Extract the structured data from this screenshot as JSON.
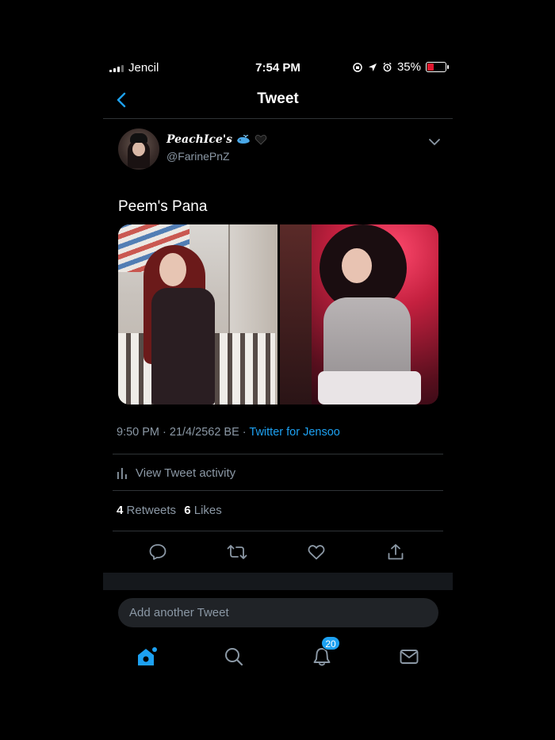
{
  "status_bar": {
    "carrier": "Jencil",
    "time": "7:54 PM",
    "battery": "35%",
    "battery_level": 0.35,
    "battery_color": "#e0152e"
  },
  "nav": {
    "title": "Tweet",
    "back_icon": "chevron-left-icon"
  },
  "tweet": {
    "display_name": "PeachIce's",
    "name_emojis": [
      "whale-icon",
      "black-heart-icon"
    ],
    "handle": "@FarinePnZ",
    "text": "Peem's Pana",
    "timestamp": "9:50 PM · 21/4/2562 BE · ",
    "source": "Twitter for Jensoo",
    "activity_label": "View Tweet activity",
    "retweets_count": "4",
    "retweets_label": "Retweets",
    "likes_count": "6",
    "likes_label": "Likes"
  },
  "actions": [
    "reply-icon",
    "retweet-icon",
    "like-icon",
    "share-icon"
  ],
  "compose": {
    "placeholder": "Add another Tweet"
  },
  "tabbar": {
    "items": [
      "home-icon",
      "search-icon",
      "notifications-icon",
      "messages-icon"
    ],
    "notifications_badge": "20"
  },
  "colors": {
    "accent": "#1da1f2",
    "secondary_text": "#8b98a5",
    "divider": "#2f3336",
    "background": "#000000"
  }
}
